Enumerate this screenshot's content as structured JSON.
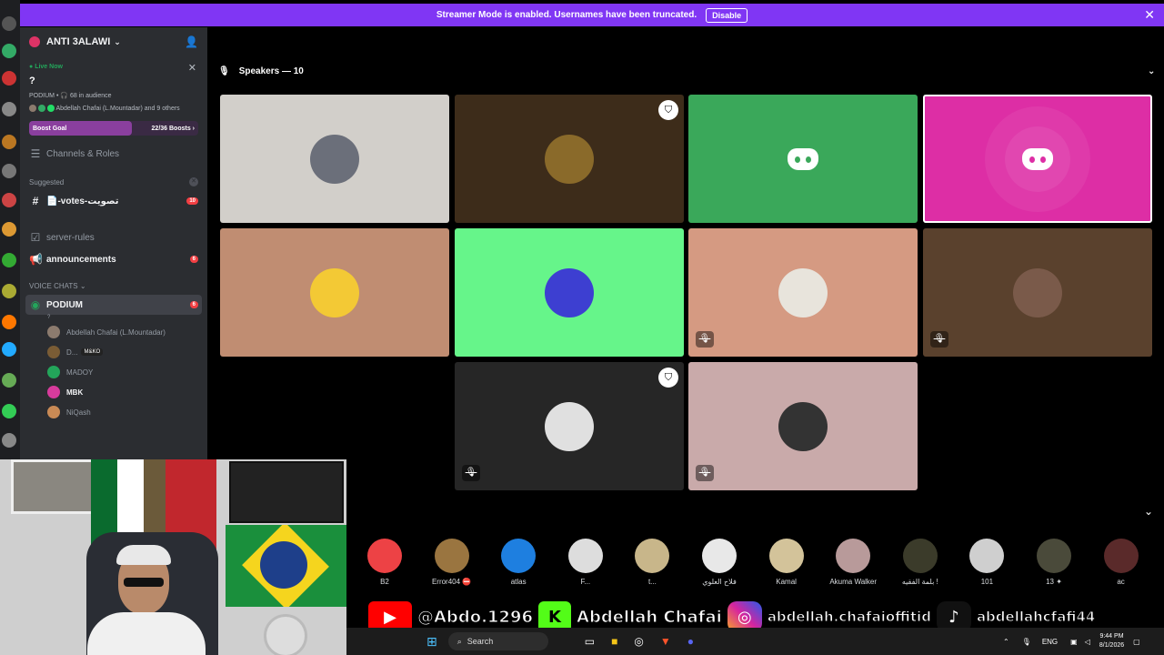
{
  "banner": {
    "text": "Streamer Mode is enabled. Usernames have been truncated.",
    "disable": "Disable"
  },
  "server": {
    "name": "ANTI 3ALAWI"
  },
  "live": {
    "label": "Live Now",
    "question": "?",
    "stage": "PODIUM • 🎧 68 in audience",
    "speakers": "Abdellah Chafai (L.Mountadar) and 9 others"
  },
  "boost": {
    "label": "Boost Goal",
    "count": "22/36 Boosts ›",
    "fraction": 0.61
  },
  "channels_roles": "Channels & Roles",
  "suggested": {
    "title": "Suggested",
    "item": "📄-votes-تصويت",
    "badge": "10"
  },
  "channels": [
    {
      "name": "server-rules",
      "bold": false
    },
    {
      "name": "announcements",
      "bold": true,
      "badge": "6"
    }
  ],
  "voice_cat": "VOICE CHATS ⌄",
  "podium": {
    "name": "PODIUM",
    "badge": "6",
    "sub": "?"
  },
  "voice_users": [
    {
      "name": "Abdellah Chafai (L.Mountadar)",
      "color": "#8c7b6e"
    },
    {
      "name": "D...",
      "extra": "M&KO",
      "color": "#7a5c35"
    },
    {
      "name": "MADOY",
      "color": "#23a55a"
    },
    {
      "name": "MBK",
      "color": "#d83b9c",
      "bold": true
    },
    {
      "name": "NiQash",
      "color": "#c98a55"
    }
  ],
  "stage_header": "Speakers — 10",
  "tiles": [
    {
      "bg": "#d2cfca",
      "av": "#6b6f7a",
      "mute": false,
      "mod": false
    },
    {
      "bg": "#3d2c1a",
      "av": "#8a6a2a",
      "mute": false,
      "mod": true
    },
    {
      "bg": "#3aa85a",
      "logo": true,
      "mute": false,
      "mod": false
    },
    {
      "bg": "#dd2ea5",
      "logo": true,
      "mute": false,
      "mod": false,
      "border": true
    },
    {
      "bg": "#c08d72",
      "av": "#f3c935",
      "mute": false,
      "mod": false
    },
    {
      "bg": "#66f58a",
      "av": "#3d3fd1",
      "mute": false,
      "mod": false
    },
    {
      "bg": "#d59a82",
      "av": "#e8e4dc",
      "mute": true,
      "mod": false
    },
    {
      "bg": "#5a412d",
      "av": "#7a5a4a",
      "mute": true,
      "mod": false
    },
    {
      "bg": "#262626",
      "av": "#e0e0e0",
      "mute": true,
      "mod": true
    },
    {
      "bg": "#c9aaaa",
      "av": "#333333",
      "mute": true,
      "mod": false
    }
  ],
  "audience": [
    {
      "name": "B2",
      "color": "#ed4245"
    },
    {
      "name": "Error404 ⛔",
      "color": "#9a7540"
    },
    {
      "name": "atlas",
      "color": "#1e7fe0"
    },
    {
      "name": "F...",
      "color": "#ddd"
    },
    {
      "name": "t...",
      "color": "#c8b68a"
    },
    {
      "name": "فلاح العلوي",
      "color": "#e8e8e8"
    },
    {
      "name": "Kamal",
      "color": "#d3c39a"
    },
    {
      "name": "Akuma Walker",
      "color": "#b89a9a"
    },
    {
      "name": "بلمة الفقيه !",
      "color": "#3b3b2a"
    },
    {
      "name": "101",
      "color": "#cfcfcf"
    },
    {
      "name": "13 ✦",
      "color": "#4a4a3a"
    },
    {
      "name": "ac",
      "color": "#5a2a2a"
    }
  ],
  "social": {
    "yt": "@Abdo.1296",
    "kick": "Abdellah Chafai",
    "ig": "abdellah.chafaioffitid",
    "tt": "abdellahcfafi44"
  },
  "taskbar": {
    "search": "Search",
    "lang": "ENG",
    "time": "9:44 PM",
    "date": "8/1/2026"
  }
}
